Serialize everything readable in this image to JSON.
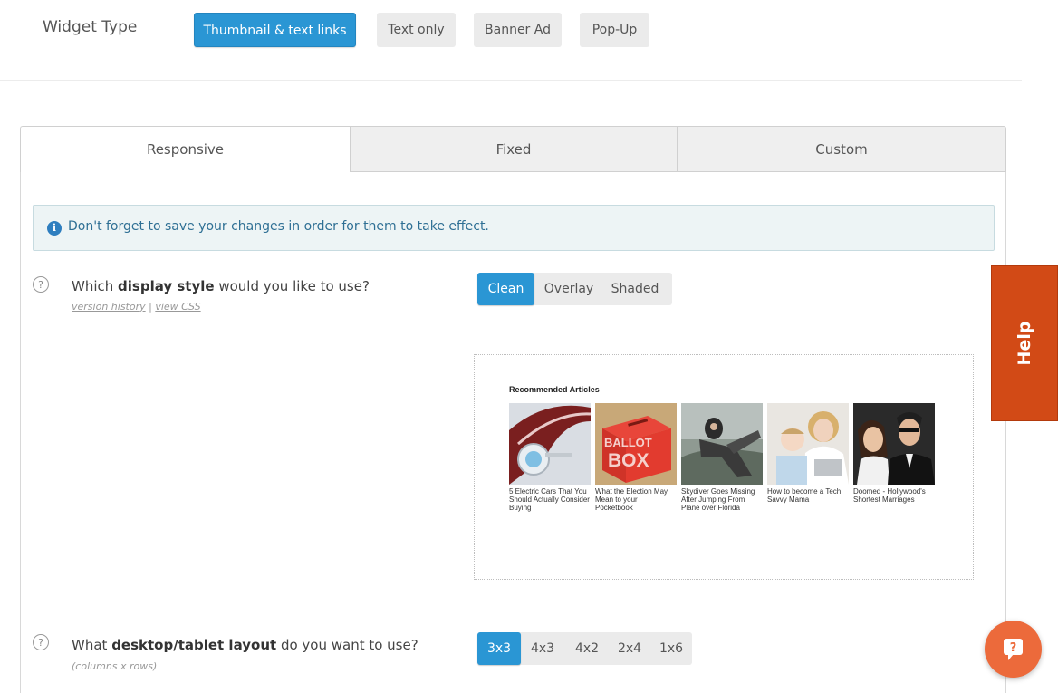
{
  "widget_type": {
    "label": "Widget Type",
    "options": [
      "Thumbnail & text links",
      "Text only",
      "Banner Ad",
      "Pop-Up"
    ],
    "selected": "Thumbnail & text links"
  },
  "tabs": [
    "Responsive",
    "Fixed",
    "Custom"
  ],
  "active_tab": "Responsive",
  "alert": {
    "text": "Don't forget to save your changes in order for them to take effect.",
    "icon": "info-icon"
  },
  "display_style": {
    "prefix": "Which ",
    "bold": "display style",
    "suffix": " would you like to use?",
    "link_version": "version history",
    "separator": " | ",
    "link_css": "view CSS",
    "options": [
      "Clean",
      "Overlay",
      "Shaded"
    ],
    "selected": "Clean"
  },
  "preview": {
    "title": "Recommended Articles",
    "articles": [
      {
        "caption": "5 Electric Cars That You Should Actually Consider Buying"
      },
      {
        "caption": "What the Election May Mean to your Pocketbook",
        "image_text_1": "BALLOT",
        "image_text_2": "BOX"
      },
      {
        "caption": "Skydiver Goes Missing After Jumping From Plane over Florida"
      },
      {
        "caption": "How to become a Tech Savvy Mama"
      },
      {
        "caption": "Doomed - Hollywood's Shortest Marriages"
      }
    ]
  },
  "layout": {
    "prefix": "What ",
    "bold": "desktop/tablet layout",
    "suffix": " do you want to use?",
    "sub": "(columns x rows)",
    "options": [
      "3x3",
      "4x3",
      "4x2",
      "2x4",
      "1x6"
    ],
    "selected": "3x3"
  },
  "help": {
    "label": "Help"
  },
  "chat": {
    "icon": "chat-question-icon",
    "glyph": "?"
  },
  "colors": {
    "accent": "#2a96d4",
    "help_bg": "#d24a16",
    "chat_bg": "#ec6a3b",
    "alert_bg": "#edf4f5"
  }
}
